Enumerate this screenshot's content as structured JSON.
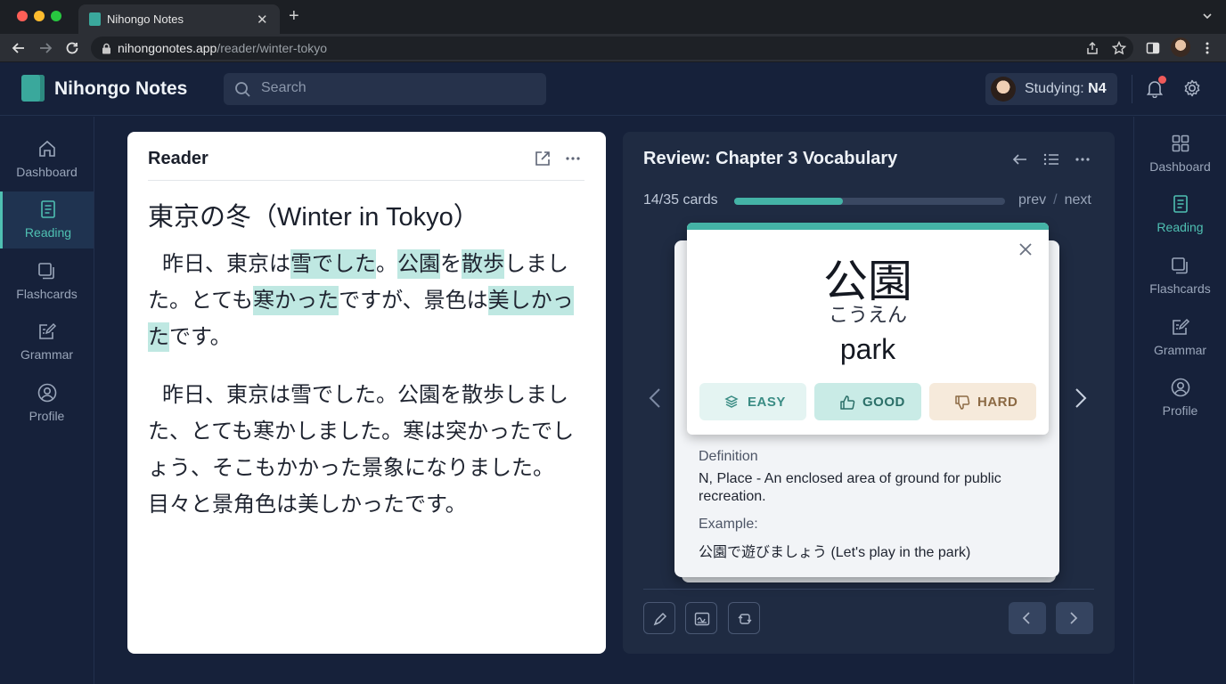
{
  "browser": {
    "tab_title": "Nihongo Notes",
    "url_domain": "nihongonotes.app",
    "url_path": "/reader/winter-tokyo"
  },
  "header": {
    "app_name": "Nihongo Notes",
    "search_placeholder": "Search",
    "studying_label": "Studying:",
    "studying_level": "N4"
  },
  "left_nav": [
    {
      "label": "Dashboard",
      "icon": "home-icon",
      "active": false
    },
    {
      "label": "Reading",
      "icon": "document-icon",
      "active": true
    },
    {
      "label": "Flashcards",
      "icon": "cards-icon",
      "active": false
    },
    {
      "label": "Grammar",
      "icon": "edit-note-icon",
      "active": false
    },
    {
      "label": "Profile",
      "icon": "user-icon",
      "active": false
    }
  ],
  "right_nav": [
    {
      "label": "Dashboard",
      "icon": "grid-icon",
      "active": false
    },
    {
      "label": "Reading",
      "icon": "document-icon",
      "active": true
    },
    {
      "label": "Flashcards",
      "icon": "cards-icon",
      "active": false
    },
    {
      "label": "Grammar",
      "icon": "edit-note-icon",
      "active": false
    },
    {
      "label": "Profile",
      "icon": "user-icon",
      "active": false
    }
  ],
  "reader": {
    "title": "Reader",
    "heading": "東京の冬（Winter in Tokyo）",
    "para1": [
      {
        "t": "昨日、東京は",
        "hl": false
      },
      {
        "t": "雪でした",
        "hl": true
      },
      {
        "t": "。",
        "hl": false
      },
      {
        "t": "公園",
        "hl": true
      },
      {
        "t": "を",
        "hl": false
      },
      {
        "t": "散歩",
        "hl": true
      },
      {
        "t": "しました。とても",
        "hl": false
      },
      {
        "t": "寒かった",
        "hl": true
      },
      {
        "t": "ですが、景色は",
        "hl": false
      },
      {
        "t": "美しかった",
        "hl": true
      },
      {
        "t": "です。",
        "hl": false
      }
    ],
    "para2": "昨日、東京は雪でした。公園を散歩しました、とても寒かしました。寒は突かったでしょう、そこもかかった景象になりました。目々と景角色は美しかったです。"
  },
  "review": {
    "title": "Review: Chapter 3 Vocabulary",
    "progress_text": "14/35 cards",
    "progress_fraction": 0.4,
    "prev_label": "prev",
    "separator": "/",
    "next_label": "next",
    "card": {
      "kanji": "公園",
      "reading": "こうえん",
      "meaning": "park",
      "buttons": {
        "easy": "EASY",
        "good": "GOOD",
        "hard": "HARD"
      }
    },
    "definition_label": "Definition",
    "definition_text": "N, Place - An enclosed area of ground for public recreation.",
    "example_label": "Example:",
    "example_text": "公園で遊びましょう (Let's play in the park)"
  },
  "colors": {
    "accent": "#44b3a6",
    "background": "#16213a",
    "panel": "#1f2b42",
    "highlight": "#bfe8e2"
  }
}
